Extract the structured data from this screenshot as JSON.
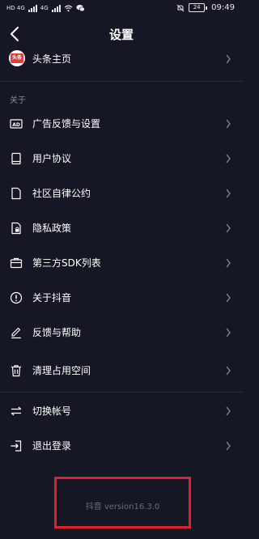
{
  "status_bar": {
    "signal_1": "HD 4G",
    "signal_2": "4G",
    "time": "09:49",
    "battery": "24"
  },
  "nav": {
    "title": "设置"
  },
  "profile_row": {
    "label": "头条主页",
    "avatar_text": "头条"
  },
  "section": {
    "about_label": "关于"
  },
  "menu": {
    "items": [
      {
        "label": "广告反馈与设置",
        "icon": "ad-icon"
      },
      {
        "label": "用户协议",
        "icon": "book-icon"
      },
      {
        "label": "社区自律公约",
        "icon": "document-icon"
      },
      {
        "label": "隐私政策",
        "icon": "privacy-lock-icon"
      },
      {
        "label": "第三方SDK列表",
        "icon": "box-icon"
      },
      {
        "label": "关于抖音",
        "icon": "info-icon"
      },
      {
        "label": "反馈与帮助",
        "icon": "pencil-icon"
      },
      {
        "label": "清理占用空间",
        "icon": "trash-icon"
      }
    ]
  },
  "account": {
    "switch_label": "切换帐号",
    "logout_label": "退出登录"
  },
  "footer": {
    "version_text": "抖音 version16.3.0"
  },
  "colors": {
    "background": "#161724",
    "highlight_box": "#e0202a"
  }
}
